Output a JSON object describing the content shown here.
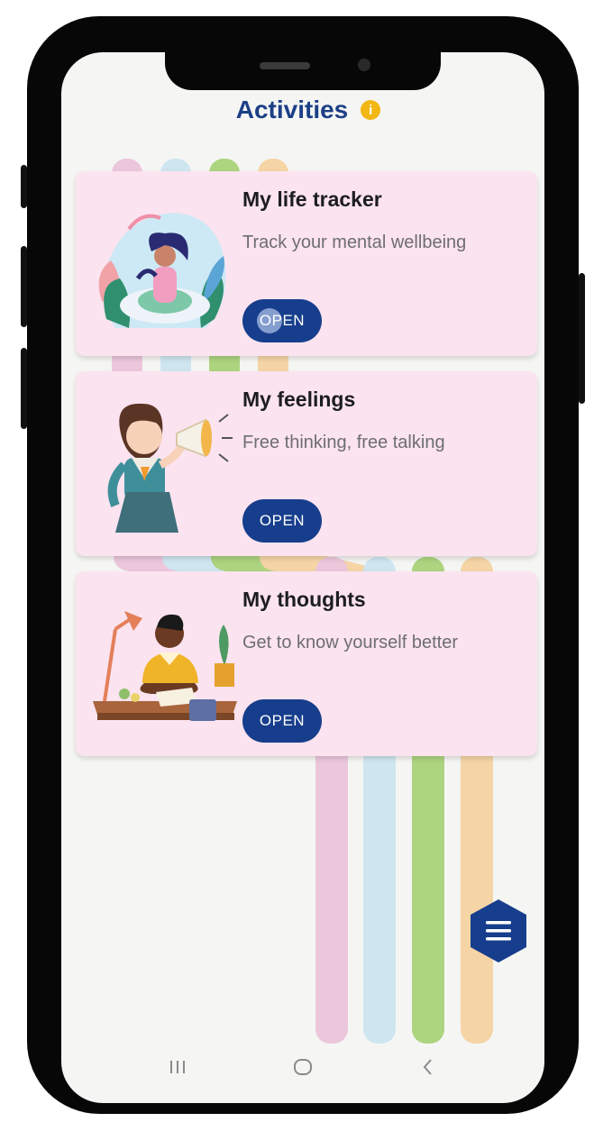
{
  "header": {
    "title": "Activities",
    "info_icon": "info-icon"
  },
  "activities": [
    {
      "title": "My life tracker",
      "subtitle": "Track your mental wellbeing",
      "button_label": "OPEN",
      "illustration": "meditating-woman-illustration"
    },
    {
      "title": "My feelings",
      "subtitle": "Free thinking, free talking",
      "button_label": "OPEN",
      "illustration": "girl-with-megaphone-illustration"
    },
    {
      "title": "My thoughts",
      "subtitle": "Get to know yourself better",
      "button_label": "OPEN",
      "illustration": "man-writing-at-desk-illustration"
    }
  ],
  "fab": {
    "icon": "menu-icon"
  },
  "system_nav": {
    "recents_icon": "recents-icon",
    "home_icon": "home-icon",
    "back_icon": "back-icon"
  },
  "colors": {
    "title": "#1c3f86",
    "button": "#173e8c",
    "card_background": "#fbe3ef",
    "info_badge": "#f2b713",
    "stripe_pink": "#e7c3d8",
    "stripe_blue": "#c9e3ef",
    "stripe_green": "#a9d27e",
    "stripe_orange": "#f3d2a2"
  }
}
